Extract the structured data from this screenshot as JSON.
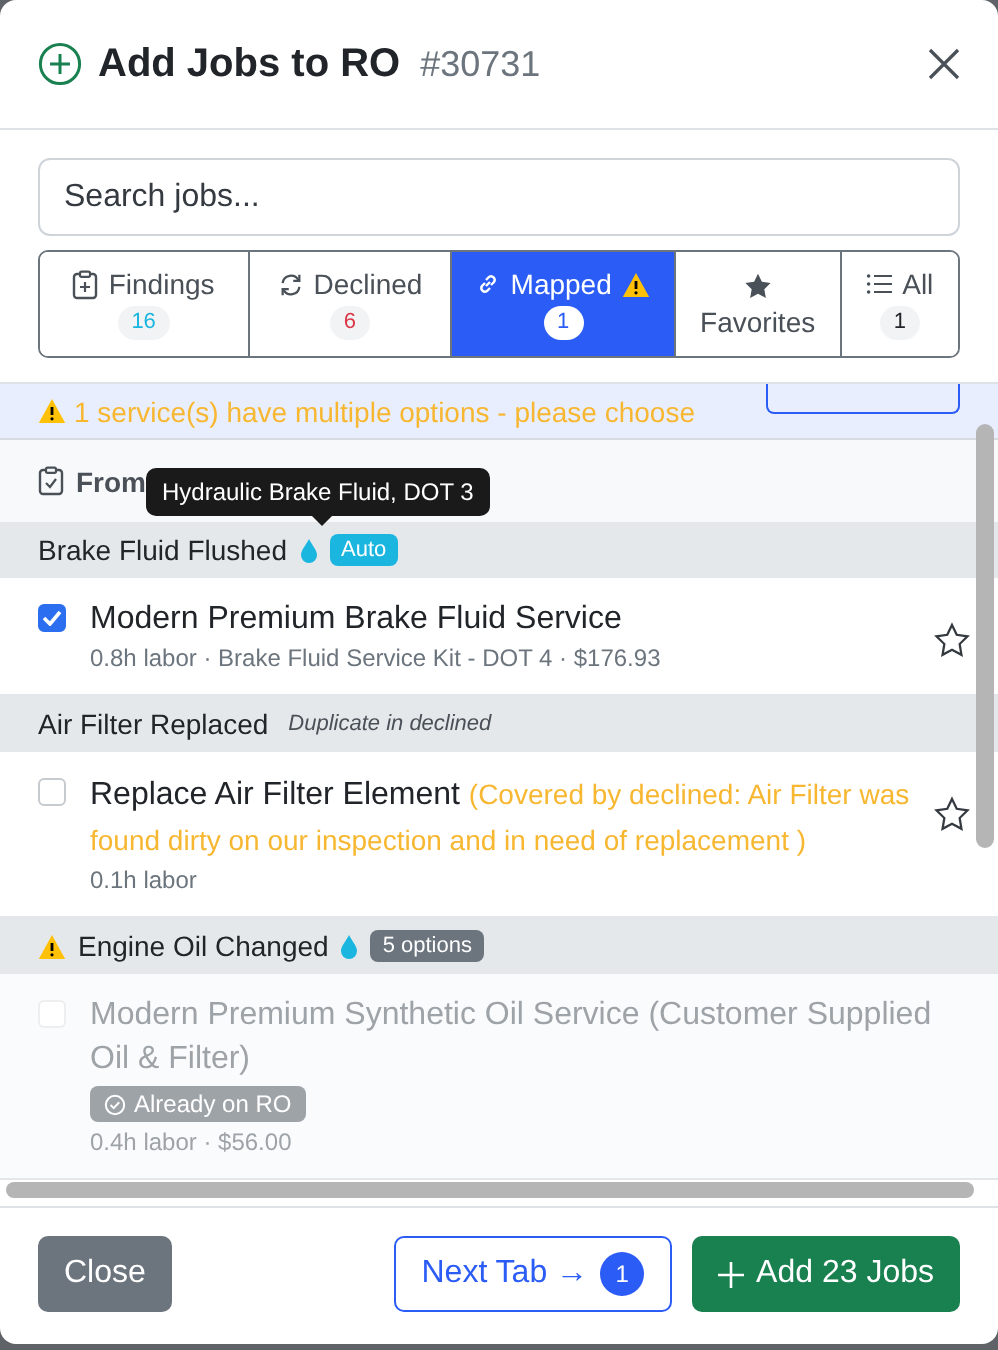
{
  "header": {
    "title": "Add Jobs to RO",
    "ro_number": "#30731"
  },
  "search": {
    "placeholder": "Search jobs..."
  },
  "tabs": [
    {
      "kind": "findings",
      "label": "Findings",
      "count": "16",
      "warning": false,
      "selected": false
    },
    {
      "kind": "declined",
      "label": "Declined",
      "count": "6",
      "warning": false,
      "selected": false
    },
    {
      "kind": "mapped",
      "label": "Mapped",
      "count": "1",
      "warning": true,
      "selected": true
    },
    {
      "kind": "favorites",
      "label": "Favorites",
      "warning": false,
      "selected": false
    },
    {
      "kind": "all",
      "label": "All",
      "count": "1",
      "warning": false,
      "selected": false
    }
  ],
  "banner": {
    "text": "1 service(s) have multiple options - please choose"
  },
  "section": {
    "label": "From"
  },
  "tooltip": {
    "text": "Hydraulic Brake Fluid, DOT 3"
  },
  "groups": [
    {
      "title": "Brake Fluid Flushed",
      "warning": false,
      "fluid": true,
      "badge": {
        "kind": "auto",
        "text": "Auto"
      },
      "items": [
        {
          "name": "Modern Premium Brake Fluid Service",
          "detail": "0.8h labor · Brake Fluid Service Kit - DOT 4 · $176.93",
          "checked": true,
          "disabled": false,
          "favorite": false
        }
      ]
    },
    {
      "title": "Air Filter Replaced",
      "note": "Duplicate in declined",
      "warning": false,
      "fluid": false,
      "items": [
        {
          "name": "Replace Air Filter Element",
          "note": "(Covered by declined: Air Filter was found dirty on our inspection and in need of replacement )",
          "detail": "0.1h labor",
          "checked": false,
          "disabled": false,
          "favorite": false
        }
      ]
    },
    {
      "title": "Engine Oil Changed",
      "warning": true,
      "fluid": true,
      "badge": {
        "kind": "count",
        "text": "5 options"
      },
      "items": [
        {
          "name": "Modern Premium Synthetic Oil Service (Customer Supplied Oil & Filter)",
          "badge": "Already on RO",
          "detail": "0.4h labor · $56.00",
          "checked": false,
          "disabled": true
        }
      ]
    }
  ],
  "footer": {
    "close": "Close",
    "next": "Next Tab →",
    "next_count": "1",
    "add": "Add 23 Jobs"
  }
}
